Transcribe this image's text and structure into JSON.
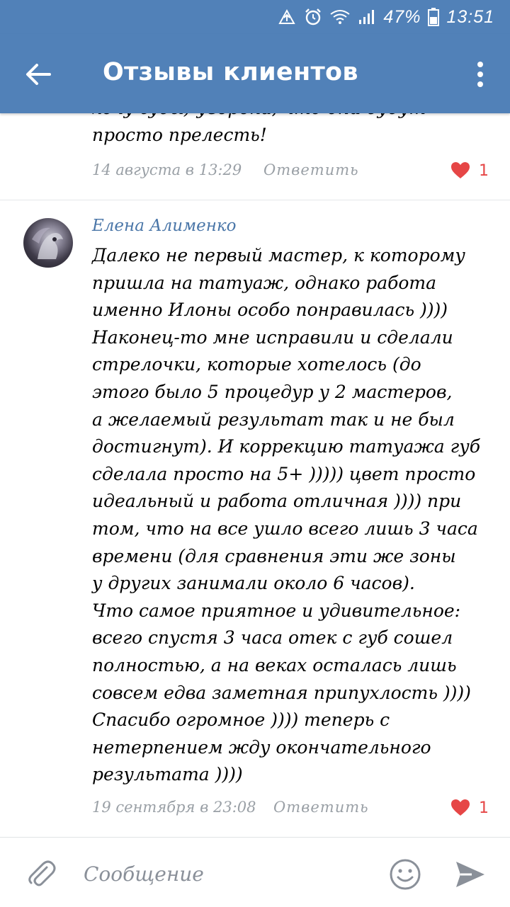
{
  "status_bar": {
    "battery_percent": "47%",
    "time": "13:51"
  },
  "toolbar": {
    "title": "Отзывы клиентов"
  },
  "previous_comment": {
    "lines": [
      "хочу губы) уверена, что они будут",
      "просто прелесть!"
    ],
    "date": "14 августа в 13:29",
    "reply_label": "Ответить",
    "likes": "1"
  },
  "review": {
    "author": "Елена Алименко",
    "lines": [
      "Далеко не первый мастер, к которому",
      "пришла на татуаж, однако работа",
      "именно Илоны особо понравилась ))))",
      "Наконец-то мне исправили и сделали",
      "стрелочки, которые хотелось (до",
      "этого было 5 процедур у 2 мастеров,",
      "а желаемый результат так и не был",
      "достигнут).  И коррекцию татуажа губ",
      "сделала просто на 5+ ))))) цвет просто",
      "идеальный и работа отличная )))) при",
      "том, что на все ушло всего лишь 3 часа",
      "времени (для сравнения эти же зоны",
      "у других занимали около 6 часов).",
      "Что самое приятное и удивительное:",
      "всего спустя 3 часа отек с губ сошел",
      "полностью, а на веках осталась лишь",
      "совсем едва заметная припухлость ))))",
      "Спасибо огромное )))) теперь с",
      "нетерпением жду окончательного",
      "результата ))))"
    ],
    "date": "19 сентября в 23:08",
    "reply_label": "Ответить",
    "likes": "1"
  },
  "composer": {
    "placeholder": "Сообщение"
  },
  "colors": {
    "header": "#5181b8",
    "author_link": "#4a76a8",
    "meta": "#9aa0a6",
    "like": "#e64646"
  }
}
